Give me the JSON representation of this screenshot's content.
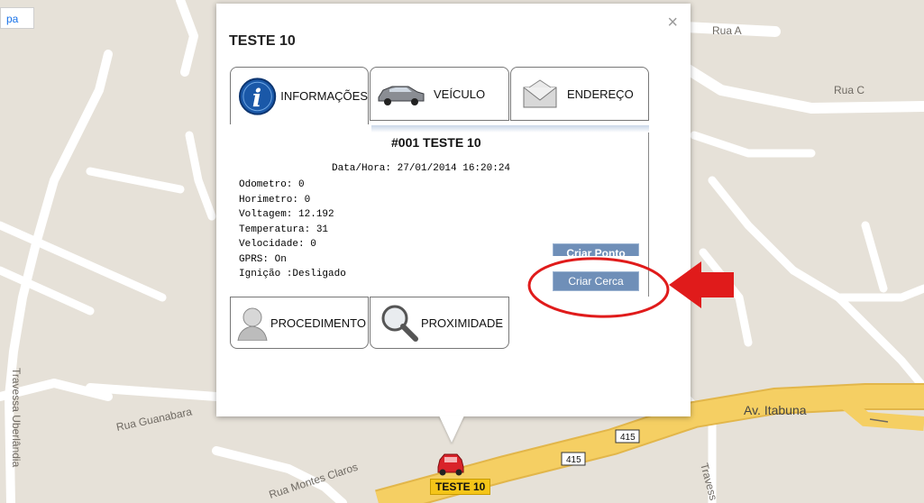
{
  "map": {
    "type_button_label": "pa",
    "streets": [
      "Rua A",
      "Rua C",
      "Rua Guanabara",
      "Rua Montes Claros",
      "Av. Itabuna",
      "Travessa Uberlândia",
      "Travess"
    ],
    "route_shields": [
      "415",
      "415"
    ]
  },
  "info_window": {
    "title": "TESTE 10",
    "close_label": "×",
    "tabs": [
      {
        "label": "INFORMAÇÕES",
        "icon": "info-icon"
      },
      {
        "label": "VEÍCULO",
        "icon": "car-icon"
      },
      {
        "label": "ENDEREÇO",
        "icon": "envelope-icon"
      }
    ],
    "panel": {
      "heading": "#001 TESTE 10",
      "datetime_label": "Data/Hora: 27/01/2014 16:20:24",
      "lines": [
        "Odometro: 0",
        "Horimetro: 0",
        "Voltagem: 12.192",
        "Temperatura: 31",
        "Velocidade: 0",
        "GPRS: On",
        "Ignição :Desligado"
      ],
      "btn_ponto": "Criar Ponto",
      "btn_cerca": "Criar Cerca"
    },
    "bottom_tabs": [
      {
        "label": "PROCEDIMENTO",
        "icon": "person-icon"
      },
      {
        "label": "PROXIMIDADE",
        "icon": "magnifier-icon"
      }
    ]
  },
  "vehicle": {
    "label": "TESTE 10"
  },
  "annotation": {
    "arrow_color": "#e01b1b",
    "circle_color": "#e01b1b"
  }
}
